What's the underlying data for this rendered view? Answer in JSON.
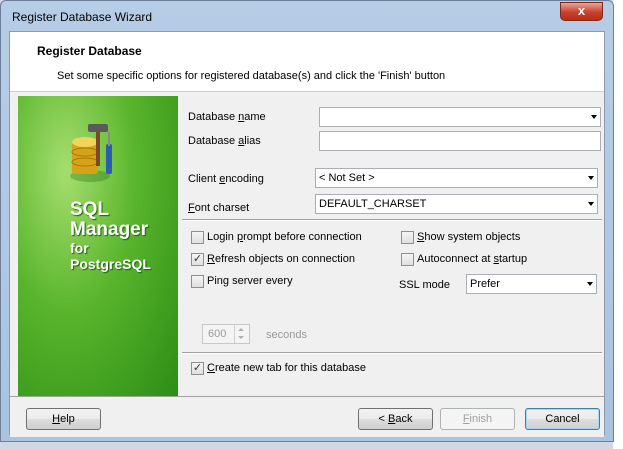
{
  "window": {
    "title": "Register Database Wizard",
    "close_glyph": "x"
  },
  "header": {
    "title": "Register Database",
    "subtitle": "Set some specific options for registered database(s) and click the 'Finish' button"
  },
  "banner": {
    "line1": "SQL",
    "line2": "Manager",
    "line3": "for",
    "line4": "PostgreSQL"
  },
  "form": {
    "database_name": {
      "label_pre": "Database ",
      "label_ul": "n",
      "label_post": "ame",
      "value": ""
    },
    "database_alias": {
      "label_pre": "Database ",
      "label_ul": "a",
      "label_post": "lias",
      "value": ""
    },
    "client_encoding": {
      "label_pre": "Client ",
      "label_ul": "e",
      "label_post": "ncoding",
      "value": "< Not Set >"
    },
    "font_charset": {
      "label_pre": "",
      "label_ul": "F",
      "label_post": "ont charset",
      "value": "DEFAULT_CHARSET"
    },
    "ssl_mode": {
      "label": "SSL mode",
      "value": "Prefer"
    },
    "options": {
      "login_prompt": {
        "pre": "Login ",
        "ul": "p",
        "post": "rompt before connection",
        "checked": false
      },
      "refresh_objects": {
        "pre": "",
        "ul": "R",
        "post": "efresh objects on connection",
        "checked": true
      },
      "ping_server": {
        "pre": "Ping server every",
        "ul": "",
        "post": "",
        "checked": false
      },
      "show_system_objects": {
        "pre": "",
        "ul": "S",
        "post": "how system objects",
        "checked": false
      },
      "autoconnect": {
        "pre": "Autoconnect at ",
        "ul": "s",
        "post": "tartup",
        "checked": false
      },
      "create_new_tab": {
        "pre": "",
        "ul": "C",
        "post": "reate new tab for this database",
        "checked": true
      }
    },
    "ping": {
      "value": "600",
      "unit": "seconds"
    },
    "check_glyph": "✓"
  },
  "buttons": {
    "help": {
      "pre": "",
      "ul": "H",
      "post": "elp"
    },
    "back": {
      "pre": "< ",
      "ul": "B",
      "post": "ack"
    },
    "finish": {
      "pre": "",
      "ul": "F",
      "post": "inish"
    },
    "cancel": {
      "pre": "Cancel",
      "ul": "",
      "post": ""
    }
  },
  "colors": {
    "banner_green": "#3f9e1f",
    "titlebar": "#b7cde6",
    "close_red": "#c8402c"
  }
}
